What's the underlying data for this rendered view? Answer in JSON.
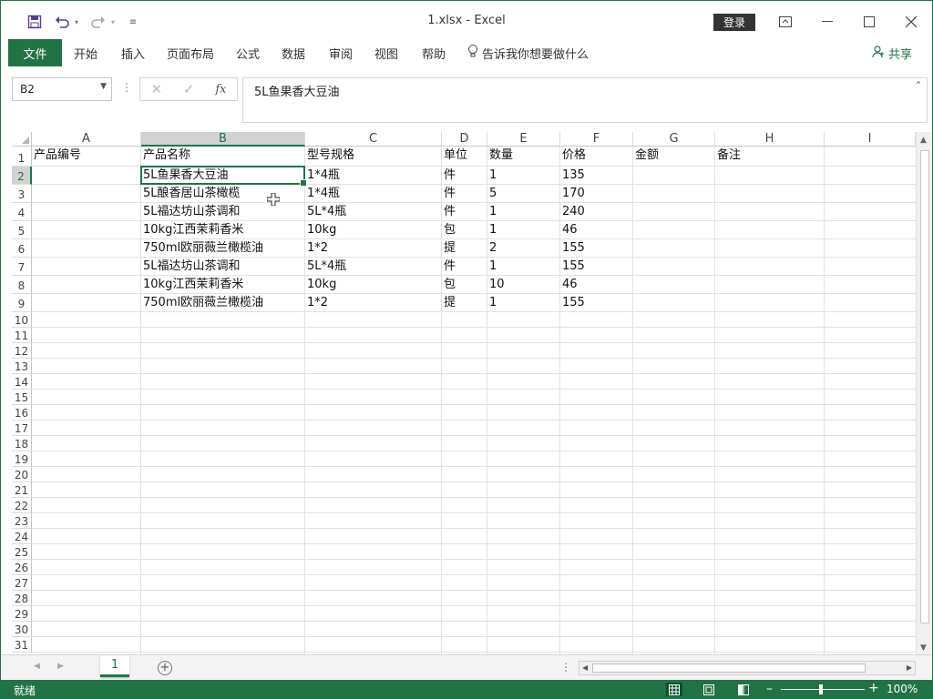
{
  "window": {
    "title": "1.xlsx  -  Excel",
    "login_label": "登录"
  },
  "ribbon": {
    "tabs": [
      "文件",
      "开始",
      "插入",
      "页面布局",
      "公式",
      "数据",
      "审阅",
      "视图",
      "帮助"
    ],
    "tell_me": "告诉我你想要做什么",
    "share": "共享"
  },
  "formula_bar": {
    "name_box": "B2",
    "content": "5L鱼果香大豆油"
  },
  "sheet": {
    "columns": [
      "A",
      "B",
      "C",
      "D",
      "E",
      "F",
      "G",
      "H",
      "I"
    ],
    "selected_column": "B",
    "selected_row": 2,
    "row_numbers": [
      1,
      2,
      3,
      4,
      5,
      6,
      7,
      8,
      9,
      10,
      11,
      12,
      13,
      14,
      15,
      16,
      17,
      18,
      19,
      20,
      21,
      22,
      23,
      24,
      25,
      26,
      27,
      28,
      29,
      30,
      31
    ],
    "headers": [
      "产品编号",
      "产品名称",
      "型号规格",
      "单位",
      "数量",
      "价格",
      "金额",
      "备注"
    ],
    "rows": [
      [
        "",
        "5L鱼果香大豆油",
        "1*4瓶",
        "件",
        "1",
        "135"
      ],
      [
        "",
        "5L酿香居山茶橄榄",
        "1*4瓶",
        "件",
        "5",
        "170"
      ],
      [
        "",
        "5L福达坊山茶调和",
        "5L*4瓶",
        "件",
        "1",
        "240"
      ],
      [
        "",
        "10kg江西茉莉香米",
        "10kg",
        "包",
        "1",
        "46"
      ],
      [
        "",
        "750ml欧丽薇兰橄榄油",
        "1*2",
        "提",
        "2",
        "155"
      ],
      [
        "",
        "5L福达坊山茶调和",
        "5L*4瓶",
        "件",
        "1",
        "155"
      ],
      [
        "",
        "10kg江西茉莉香米",
        "10kg",
        "包",
        "10",
        "46"
      ],
      [
        "",
        "750ml欧丽薇兰橄榄油",
        "1*2",
        "提",
        "1",
        "155"
      ]
    ]
  },
  "sheet_tabs": [
    "1"
  ],
  "status": {
    "ready": "就绪",
    "zoom": "100%",
    "zoom_level": 100
  },
  "colors": {
    "accent": "#217346"
  }
}
